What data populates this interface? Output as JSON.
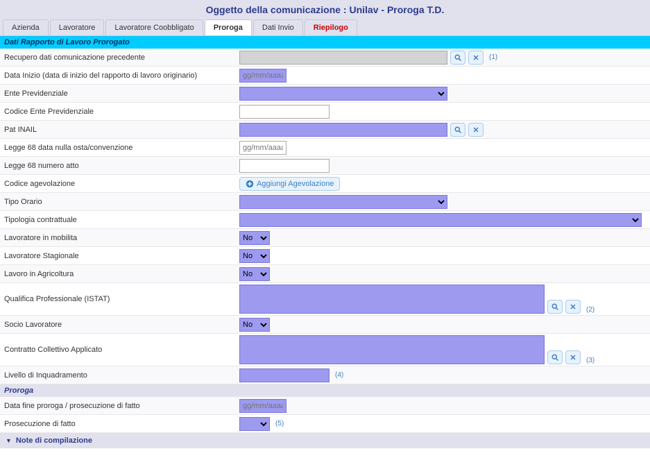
{
  "header": {
    "title": "Oggetto della comunicazione : Unilav - Proroga T.D."
  },
  "tabs": [
    {
      "label": "Azienda"
    },
    {
      "label": "Lavoratore"
    },
    {
      "label": "Lavoratore Coobbligato"
    },
    {
      "label": "Proroga",
      "active": true
    },
    {
      "label": "Dati Invio"
    },
    {
      "label": "Riepilogo",
      "red": true
    }
  ],
  "section1": {
    "title": "Dati Rapporto di Lavoro Prorogato"
  },
  "rows": {
    "recupero": {
      "label": "Recupero dati comunicazione precedente",
      "note": "(1)"
    },
    "dataInizio": {
      "label": "Data Inizio (data di inizio del rapporto di lavoro originario)",
      "placeholder": "gg/mm/aaaa"
    },
    "entePrev": {
      "label": "Ente Previdenziale"
    },
    "codiceEnte": {
      "label": "Codice Ente Previdenziale"
    },
    "patInail": {
      "label": "Pat INAIL"
    },
    "legge68data": {
      "label": "Legge 68 data nulla osta/convenzione",
      "placeholder": "gg/mm/aaaa"
    },
    "legge68num": {
      "label": "Legge 68 numero atto"
    },
    "codAgev": {
      "label": "Codice agevolazione",
      "btn": "Aggiungi Agevolazione"
    },
    "tipoOrario": {
      "label": "Tipo Orario"
    },
    "tipologia": {
      "label": "Tipologia contrattuale"
    },
    "lavMobilita": {
      "label": "Lavoratore in mobilita",
      "value": "No"
    },
    "lavStagionale": {
      "label": "Lavoratore Stagionale",
      "value": "No"
    },
    "lavAgricoltura": {
      "label": "Lavoro in Agricoltura",
      "value": "No"
    },
    "qualifica": {
      "label": "Qualifica Professionale (ISTAT)",
      "note": "(2)"
    },
    "socio": {
      "label": "Socio Lavoratore",
      "value": "No"
    },
    "ccnl": {
      "label": "Contratto Collettivo Applicato",
      "note": "(3)"
    },
    "livello": {
      "label": "Livello di Inquadramento",
      "note": "(4)"
    }
  },
  "section2": {
    "title": "Proroga"
  },
  "rows2": {
    "dataFine": {
      "label": "Data fine proroga / prosecuzione di fatto",
      "placeholder": "gg/mm/aaaa"
    },
    "prosecuzione": {
      "label": "Prosecuzione di fatto",
      "note": "(5)"
    }
  },
  "noteBar": {
    "label": "Note di compilazione"
  },
  "selectOptions": {
    "no": "No"
  }
}
